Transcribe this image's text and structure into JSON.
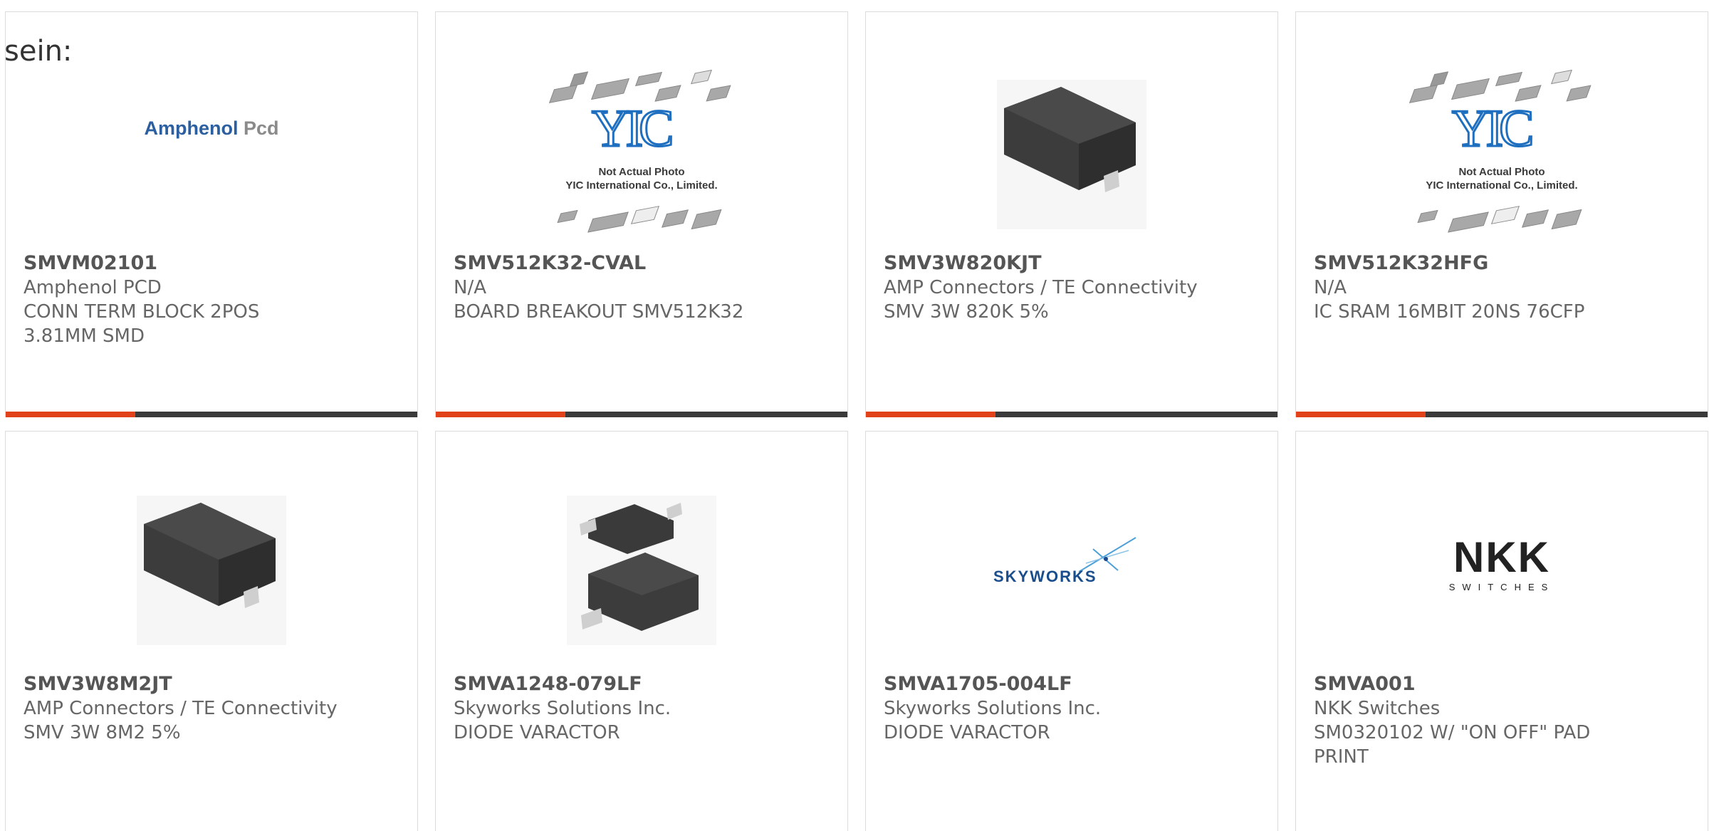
{
  "intro_text": "sein:",
  "colors": {
    "accent": "#e2421a",
    "bar": "#3a3a3a",
    "border": "#dcdcdc",
    "amphenol_blue": "#2c5fa0",
    "yic_blue": "#1f6fc0",
    "skyworks_blue": "#1a4d8c",
    "nkk_red": "#d8262c"
  },
  "cards": [
    {
      "part_no": "SMVM02101",
      "manufacturer": "Amphenol PCD",
      "description": "CONN TERM BLOCK 2POS 3.81MM SMD",
      "image": "amphenol-pcd-logo",
      "logo_main": "Amphenol",
      "logo_sub": "Pcd"
    },
    {
      "part_no": "SMV512K32-CVAL",
      "manufacturer": "N/A",
      "description": "BOARD BREAKOUT SMV512K32",
      "image": "yic-placeholder",
      "logo_main": "YIC",
      "caption_1": "Not Actual Photo",
      "caption_2": "YIC International Co., Limited."
    },
    {
      "part_no": "SMV3W820KJT",
      "manufacturer": "AMP Connectors / TE Connectivity",
      "description": "SMV 3W 820K 5%",
      "image": "smd-component-photo"
    },
    {
      "part_no": "SMV512K32HFG",
      "manufacturer": "N/A",
      "description": "IC SRAM 16MBIT 20NS 76CFP",
      "image": "yic-placeholder",
      "logo_main": "YIC",
      "caption_1": "Not Actual Photo",
      "caption_2": "YIC International Co., Limited."
    },
    {
      "part_no": "SMV3W8M2JT",
      "manufacturer": "AMP Connectors / TE Connectivity",
      "description": "SMV 3W 8M2 5%",
      "image": "smd-component-photo"
    },
    {
      "part_no": "SMVA1248-079LF",
      "manufacturer": "Skyworks Solutions Inc.",
      "description": "DIODE VARACTOR",
      "image": "sod-diode-photo"
    },
    {
      "part_no": "SMVA1705-004LF",
      "manufacturer": "Skyworks Solutions Inc.",
      "description": "DIODE VARACTOR",
      "image": "skyworks-logo",
      "logo_main": "SKYWORKS"
    },
    {
      "part_no": "SMVA001",
      "manufacturer": "NKK Switches",
      "description": "SM0320102 W/ \"ON OFF\" PAD PRINT",
      "image": "nkk-switches-logo",
      "logo_main": "NKK",
      "logo_sub": "SWITCHES"
    }
  ]
}
